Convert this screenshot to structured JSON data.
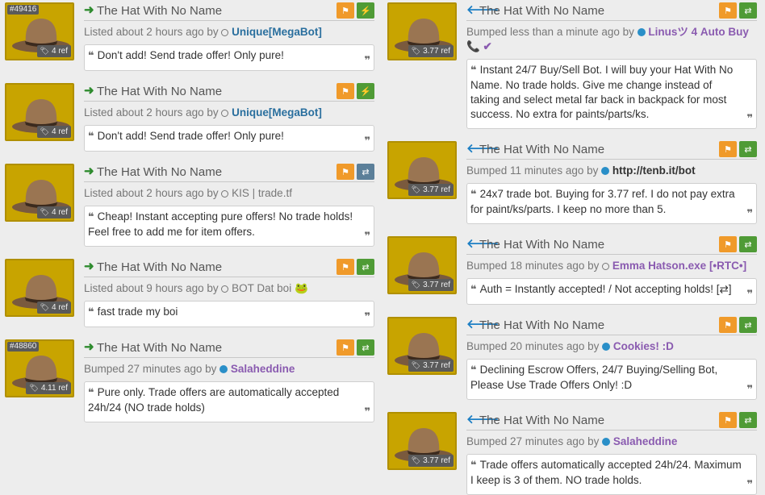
{
  "colors": {
    "thumb_bg": "#c8a400",
    "btn_flag": "#f09a2a",
    "btn_green": "#4f9b36",
    "btn_slate": "#5b7f99",
    "arrow_buy": "#2e8b2e",
    "arrow_sell": "#1e7fc4",
    "user_blue": "#2a6f9e",
    "user_purple": "#8a5bb0"
  },
  "left": [
    {
      "id_tag": "#49416",
      "price": "4 ref",
      "title": "The Hat With No Name",
      "meta_prefix": "Listed about 2 hours ago by",
      "user": "Unique[MegaBot]",
      "comment": "Don't add! Send trade offer! Only pure!",
      "btn2_icon": "lightning-icon"
    },
    {
      "id_tag": "",
      "price": "4 ref",
      "title": "The Hat With No Name",
      "meta_prefix": "Listed about 2 hours ago by",
      "user": "Unique[MegaBot]",
      "comment": "Don't add! Send trade offer! Only pure!",
      "btn2_icon": "lightning-icon"
    },
    {
      "id_tag": "",
      "price": "4 ref",
      "title": "The Hat With No Name",
      "meta_prefix": "Listed about 2 hours ago by",
      "user": "KIS | trade.tf",
      "comment": "Cheap! Instant accepting pure offers! No trade holds! Feel free to add me for item offers.",
      "btn2_icon": "exchange-icon"
    },
    {
      "id_tag": "",
      "price": "4 ref",
      "title": "The Hat With No Name",
      "meta_prefix": "Listed about 9 hours ago by",
      "user": "BOT Dat boi 🐸",
      "comment": "fast trade my boi",
      "btn2_icon": "exchange-icon"
    },
    {
      "id_tag": "#48860",
      "price": "4.11 ref",
      "title": "The Hat With No Name",
      "meta_prefix": "Bumped 27 minutes ago by",
      "user": "Salaheddine",
      "comment": "Pure only. Trade offers are automatically accepted 24h/24 (NO trade holds)",
      "btn2_icon": "exchange-icon"
    }
  ],
  "right": [
    {
      "price": "3.77 ref",
      "title": "The Hat With No Name",
      "meta_prefix": "Bumped less than a minute ago by",
      "user": "Linusツ 4 Auto Buy📞 ✔",
      "comment": "Instant 24/7 Buy/Sell Bot. I will buy your Hat With No Name. No trade holds. Give me change instead of taking and select metal far back in backpack for most success. No extra for paints/parts/ks."
    },
    {
      "price": "3.77 ref",
      "title": "The Hat With No Name",
      "meta_prefix": "Bumped 11 minutes ago by",
      "user": "http://tenb.it/bot",
      "comment": "24x7 trade bot. Buying for 3.77 ref. I do not pay extra for paint/ks/parts. I keep no more than 5."
    },
    {
      "price": "3.77 ref",
      "title": "The Hat With No Name",
      "meta_prefix": "Bumped 18 minutes ago by",
      "user": "Emma Hatson.exe [•RTC•]",
      "comment": "Auth = Instantly accepted! / Not accepting holds! [⇄]"
    },
    {
      "price": "3.77 ref",
      "title": "The Hat With No Name",
      "meta_prefix": "Bumped 20 minutes ago by",
      "user": "Cookies! :D",
      "comment": "Declining Escrow Offers, 24/7 Buying/Selling Bot, Please Use Trade Offers Only! :D"
    },
    {
      "price": "3.77 ref",
      "title": "The Hat With No Name",
      "meta_prefix": "Bumped 27 minutes ago by",
      "user": "Salaheddine",
      "comment": "Trade offers automatically accepted 24h/24. Maximum I keep is 3 of them. NO trade holds."
    }
  ]
}
